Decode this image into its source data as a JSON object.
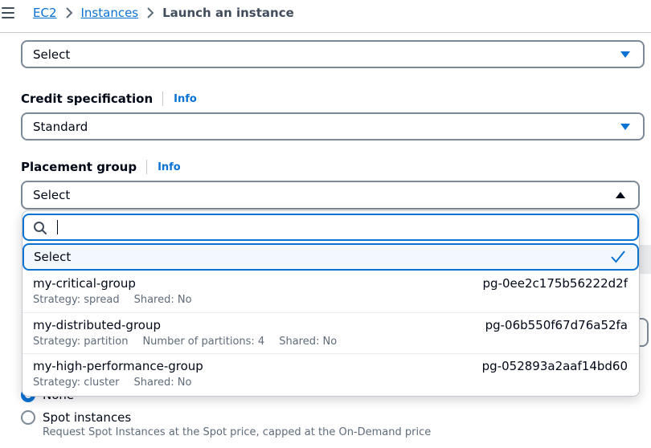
{
  "breadcrumb": {
    "items": [
      "EC2",
      "Instances"
    ],
    "current": "Launch an instance"
  },
  "top_select": {
    "value": "Select"
  },
  "credit": {
    "label": "Credit specification",
    "info": "Info",
    "value": "Standard"
  },
  "placement": {
    "label": "Placement group",
    "info": "Info",
    "value": "Select",
    "search_placeholder": "",
    "selected_option": "Select",
    "options": [
      {
        "name": "my-critical-group",
        "id": "pg-0ee2c175b56222d2f",
        "meta": [
          "Strategy: spread",
          "Shared: No"
        ]
      },
      {
        "name": "my-distributed-group",
        "id": "pg-06b550f67d76a52fa",
        "meta": [
          "Strategy: partition",
          "Number of partitions: 4",
          "Shared: No"
        ]
      },
      {
        "name": "my-high-performance-group",
        "id": "pg-052893a2aaf14bd60",
        "meta": [
          "Strategy: cluster",
          "Shared: No"
        ]
      }
    ]
  },
  "purchasing": {
    "none_label": "None",
    "spot_label": "Spot instances",
    "spot_desc": "Request Spot Instances at the Spot price, capped at the On-Demand price"
  },
  "colors": {
    "link": "#0972d3",
    "border": "#7d8998",
    "text": "#000716",
    "muted": "#5f6b7a",
    "selected_bg": "#f2f8fd"
  }
}
